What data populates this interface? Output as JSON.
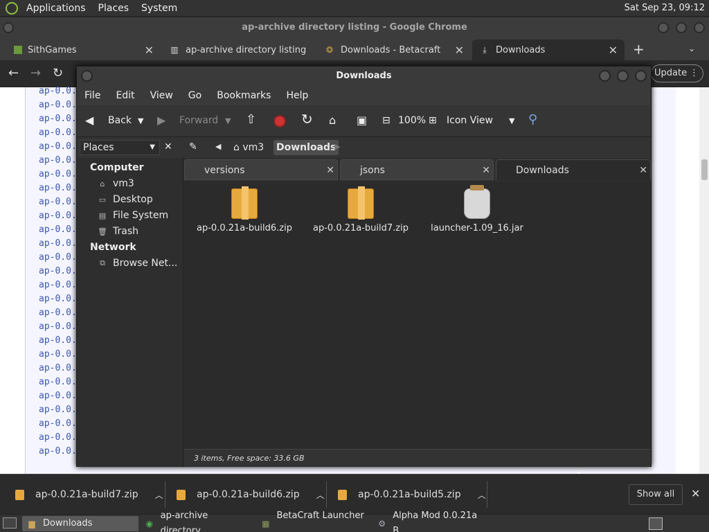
{
  "top_panel": {
    "menus": [
      "Applications",
      "Places",
      "System"
    ],
    "clock": "Sat Sep 23, 09:12"
  },
  "chrome": {
    "title": "ap-archive directory listing - Google Chrome",
    "tabs": [
      {
        "label": "SithGames",
        "icon": "minecraft-block-icon"
      },
      {
        "label": "ap-archive directory listing",
        "icon": "archive-icon"
      },
      {
        "label": "Downloads - Betacraft",
        "icon": "betacraft-icon"
      },
      {
        "label": "Downloads",
        "icon": "download-icon"
      }
    ],
    "update_label": "Update"
  },
  "webpage": {
    "rows": [
      "ap-0.0.",
      "ap-0.0.",
      "ap-0.0.",
      "ap-0.0.",
      "ap-0.0.",
      "ap-0.0.",
      "ap-0.0.",
      "ap-0.0.",
      "ap-0.0.",
      "ap-0.0.",
      "ap-0.0.",
      "ap-0.0.",
      "ap-0.0.",
      "ap-0.0.",
      "ap-0.0.",
      "ap-0.0.",
      "ap-0.0.",
      "ap-0.0.",
      "ap-0.0.",
      "ap-0.0.",
      "ap-0.0.",
      "ap-0.0.",
      "ap-0.0.",
      "ap-0.0.",
      "ap-0.0.",
      "ap-0.0.",
      "ap-0.0."
    ]
  },
  "nautilus": {
    "title": "Downloads",
    "menus": [
      "File",
      "Edit",
      "View",
      "Go",
      "Bookmarks",
      "Help"
    ],
    "toolbar": {
      "back": "Back",
      "forward": "Forward",
      "zoom": "100%",
      "view_mode": "Icon View"
    },
    "location": {
      "places_label": "Places",
      "crumbs": [
        "vm3",
        "Downloads"
      ]
    },
    "sidebar": {
      "computer_header": "Computer",
      "computer_items": [
        "vm3",
        "Desktop",
        "File System",
        "Trash"
      ],
      "network_header": "Network",
      "network_items": [
        "Browse Net..."
      ]
    },
    "tabs": [
      "versions",
      "jsons",
      "Downloads"
    ],
    "files": [
      {
        "name": "ap-0.0.21a-build6.zip",
        "type": "zip"
      },
      {
        "name": "ap-0.0.21a-build7.zip",
        "type": "zip"
      },
      {
        "name": "launcher-1.09_16.jar",
        "type": "jar"
      }
    ],
    "status": "3 items, Free space: 33.6 GB"
  },
  "downloads_bar": {
    "items": [
      "ap-0.0.21a-build7.zip",
      "ap-0.0.21a-build6.zip",
      "ap-0.0.21a-build5.zip"
    ],
    "show_all": "Show all"
  },
  "taskbar": {
    "items": [
      "Downloads",
      "ap-archive directory...",
      "BetaCraft Launcher ...",
      "Alpha Mod 0.0.21a B..."
    ]
  }
}
